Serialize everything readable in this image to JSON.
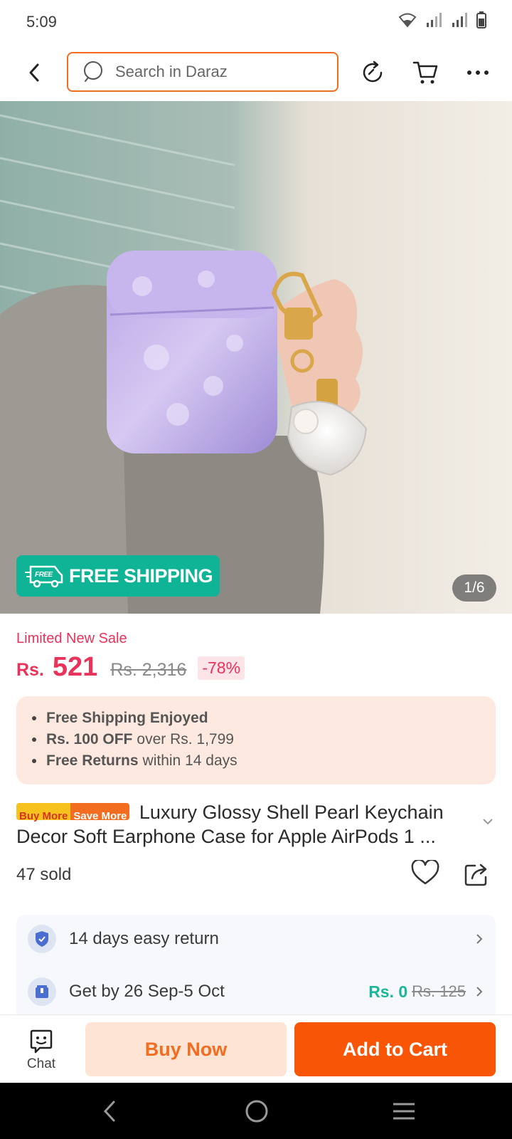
{
  "status": {
    "time": "5:09"
  },
  "header": {
    "search_placeholder": "Search in Daraz",
    "icons": [
      "back-icon",
      "search-icon",
      "refresh-icon",
      "cart-icon",
      "more-icon"
    ]
  },
  "image": {
    "counter": "1/6",
    "badge_free": "FREE",
    "badge_text": "FREE SHIPPING"
  },
  "price": {
    "sale_label": "Limited New Sale",
    "currency": "Rs.",
    "current": "521",
    "original": "Rs. 2,316",
    "discount": "-78%"
  },
  "benefits": [
    {
      "bold": "Free Shipping Enjoyed",
      "rest": ""
    },
    {
      "bold": "Rs. 100 OFF",
      "rest": "over Rs. 1,799"
    },
    {
      "bold": "Free Returns",
      "rest": "within 14 days"
    }
  ],
  "product": {
    "badge_a": "Buy More",
    "badge_b": "Save More",
    "title": "Luxury Glossy Shell Pearl Keychain Decor Soft Earphone Case for Apple AirPods 1 ...",
    "sold": "47 sold"
  },
  "service": {
    "return": "14 days easy return",
    "delivery": "Get by 26 Sep-5 Oct",
    "shipping_fee": "Rs. 0",
    "shipping_old": "Rs. 125"
  },
  "actions": {
    "chat": "Chat",
    "buy_now": "Buy Now",
    "add_to_cart": "Add to Cart"
  },
  "colors": {
    "accent": "#f85606",
    "price": "#e8335a",
    "free_ship": "#0fb395"
  }
}
